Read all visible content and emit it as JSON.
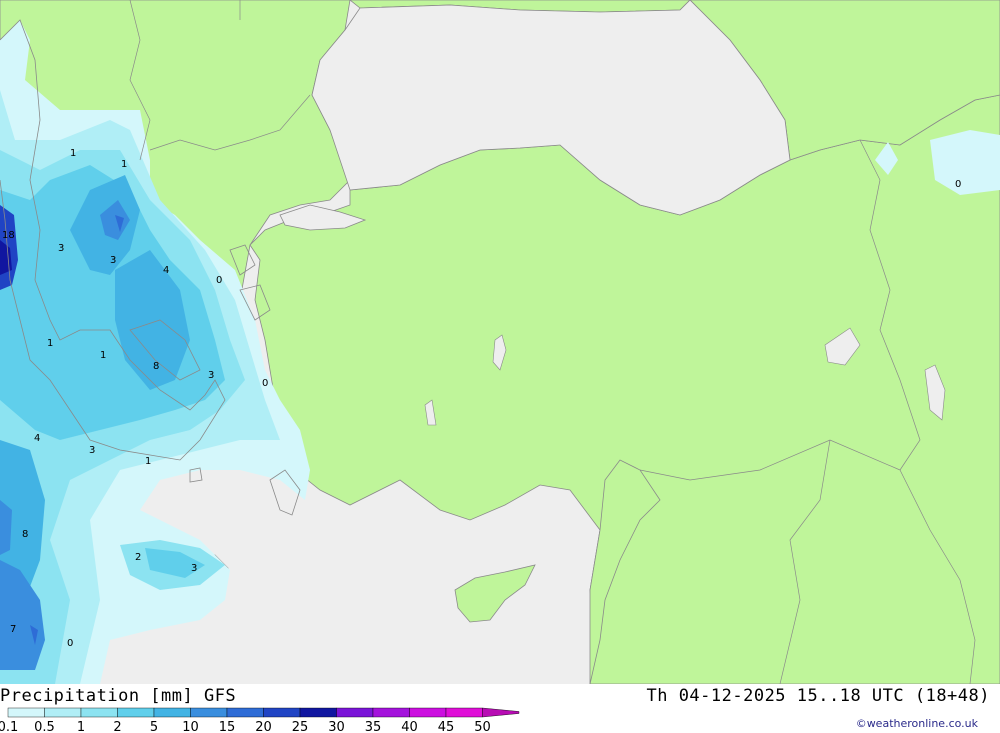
{
  "header": {
    "title_left": "Precipitation [mm] GFS",
    "title_right": "Th 04-12-2025 15..18 UTC (18+48)",
    "credit": "©weatheronline.co.uk"
  },
  "legend": {
    "labels": [
      "0.1",
      "0.5",
      "1",
      "2",
      "5",
      "10",
      "15",
      "20",
      "25",
      "30",
      "35",
      "40",
      "45",
      "50"
    ],
    "colors": [
      "#d4f7fb",
      "#b0eef6",
      "#8ce3f1",
      "#60cfeb",
      "#42b3e4",
      "#3a8ede",
      "#2e6cd6",
      "#2044c4",
      "#1016a0",
      "#7a14d8",
      "#a412dc",
      "#cc0fe0",
      "#e00ed8",
      "#b80cb4"
    ]
  },
  "colors": {
    "land": "#bff59a",
    "sea": "#eeeeee",
    "border": "#8a8a8a"
  },
  "map_labels": [
    {
      "name": "label-1a",
      "text": "1"
    },
    {
      "name": "label-1b",
      "text": "1"
    },
    {
      "name": "label-18",
      "text": "18"
    },
    {
      "name": "label-3a",
      "text": "3"
    },
    {
      "name": "label-3b",
      "text": "3"
    },
    {
      "name": "label-4a",
      "text": "4"
    },
    {
      "name": "label-0a",
      "text": "0"
    },
    {
      "name": "label-1c",
      "text": "1"
    },
    {
      "name": "label-1d",
      "text": "1"
    },
    {
      "name": "label-8a",
      "text": "8"
    },
    {
      "name": "label-3c",
      "text": "3"
    },
    {
      "name": "label-0b",
      "text": "0"
    },
    {
      "name": "label-4b",
      "text": "4"
    },
    {
      "name": "label-3d",
      "text": "3"
    },
    {
      "name": "label-1e",
      "text": "1"
    },
    {
      "name": "label-8b",
      "text": "8"
    },
    {
      "name": "label-2",
      "text": "2"
    },
    {
      "name": "label-3e",
      "text": "3"
    },
    {
      "name": "label-7",
      "text": "7"
    },
    {
      "name": "label-0c",
      "text": "0"
    },
    {
      "name": "label-0d",
      "text": "0"
    }
  ]
}
